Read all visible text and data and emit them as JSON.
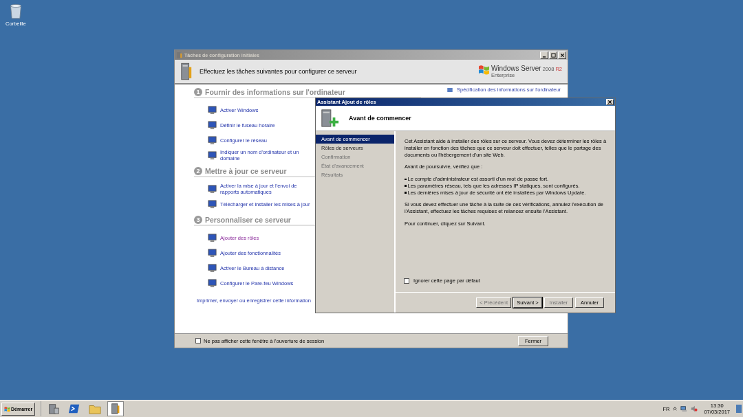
{
  "desktop_icons": [
    {
      "label": "Corbeille"
    }
  ],
  "background_window": {
    "title": "Tâches de configuration initiales",
    "header": "Effectuez les tâches suivantes pour configurer ce serveur",
    "logo": {
      "name": "Windows Server",
      "version": "2008",
      "suffix": "R2",
      "edition": "Enterprise"
    },
    "side_link": "Spécification des informations sur l'ordinateur",
    "sections": [
      {
        "number": "1",
        "heading": "Fournir des informations sur l'ordinateur",
        "items": [
          {
            "label": "Activer Windows",
            "visited": false
          },
          {
            "label": "Définir le fuseau horaire",
            "visited": false
          },
          {
            "label": "Configurer le réseau",
            "visited": false
          },
          {
            "label": "Indiquer un nom d'ordinateur et un domaine",
            "visited": false
          }
        ]
      },
      {
        "number": "2",
        "heading": "Mettre à jour ce serveur",
        "items": [
          {
            "label": "Activer la mise à jour et l'envoi de rapports automatiques",
            "visited": false
          },
          {
            "label": "Télécharger et installer les mises à jour",
            "visited": false
          }
        ]
      },
      {
        "number": "3",
        "heading": "Personnaliser ce serveur",
        "items": [
          {
            "label": "Ajouter des rôles",
            "visited": true
          },
          {
            "label": "Ajouter des fonctionnalités",
            "visited": false
          },
          {
            "label": "Activer le Bureau à distance",
            "visited": false
          },
          {
            "label": "Configurer le Pare-feu Windows",
            "visited": false
          }
        ]
      }
    ],
    "print_link": "Imprimer, envoyer ou enregistrer cette information",
    "footer_checkbox": {
      "label": "Ne pas afficher cette fenêtre à l'ouverture de session",
      "checked": false
    },
    "close_button": "Fermer"
  },
  "dialog": {
    "title": "Assistant Ajout de rôles",
    "heading": "Avant de commencer",
    "steps": [
      {
        "label": "Avant de commencer",
        "selected": true,
        "disabled": false
      },
      {
        "label": "Rôles de serveurs",
        "selected": false,
        "disabled": false
      },
      {
        "label": "Confirmation",
        "selected": false,
        "disabled": true
      },
      {
        "label": "État d'avancement",
        "selected": false,
        "disabled": true
      },
      {
        "label": "Résultats",
        "selected": false,
        "disabled": true
      }
    ],
    "intro": "Cet Assistant aide à installer des rôles sur ce serveur. Vous devez déterminer les rôles à installer en fonction des tâches que ce serveur doit effectuer, telles que le partage des documents ou l'hébergement d'un site Web.",
    "check_intro": "Avant de poursuivre, vérifiez que :",
    "bullets": [
      "Le compte d'administrateur est assorti d'un mot de passe fort.",
      "Les paramètres réseau, tels que les adresses IP statiques, sont configurés.",
      "Les dernières mises à jour de sécurité ont été installées par Windows Update."
    ],
    "advice": "Si vous devez effectuer une tâche à la suite de ces vérifications, annulez l'exécution de l'Assistant, effectuez les tâches requises et relancez ensuite l'Assistant.",
    "continue": "Pour continuer, cliquez sur Suivant.",
    "skip_checkbox": {
      "label": "Ignorer cette page par défaut",
      "checked": false
    },
    "buttons": [
      {
        "label": "< Précédent",
        "disabled": true,
        "default": false
      },
      {
        "label": "Suivant >",
        "disabled": false,
        "default": true
      },
      {
        "label": "Installer",
        "disabled": true,
        "default": false
      },
      {
        "label": "Annuler",
        "disabled": false,
        "default": false
      }
    ]
  },
  "taskbar": {
    "start": "Démarrer",
    "quick_launch": [
      {
        "kind": "server",
        "selected": false
      },
      {
        "kind": "terminal",
        "selected": false
      },
      {
        "kind": "folder",
        "selected": false
      },
      {
        "kind": "config",
        "selected": true
      }
    ],
    "language": "FR",
    "time": "13:30",
    "date": "07/03/2017"
  }
}
